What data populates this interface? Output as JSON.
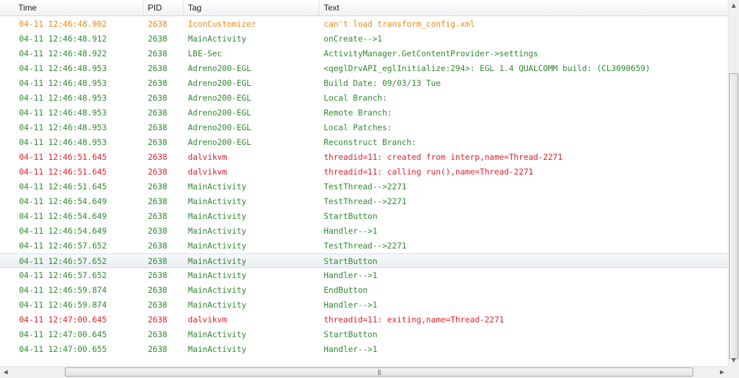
{
  "columns": {
    "time": "Time",
    "pid": "PID",
    "tag": "Tag",
    "text": "Text"
  },
  "colors": {
    "info": "#2f8a2f",
    "warn": "#e8891a",
    "error": "#e0202a"
  },
  "selected_row": 16,
  "rows": [
    {
      "time": "04-11 12:46:48.902",
      "pid": "2638",
      "tag": "IconCustomizer",
      "text": "can't load transform_config.xml",
      "level": "warn"
    },
    {
      "time": "04-11 12:46:48.912",
      "pid": "2638",
      "tag": "MainActivity",
      "text": "onCreate-->1",
      "level": "info"
    },
    {
      "time": "04-11 12:46:48.922",
      "pid": "2638",
      "tag": "LBE-Sec",
      "text": "ActivityManager.GetContentProvider->settings",
      "level": "info"
    },
    {
      "time": "04-11 12:46:48.953",
      "pid": "2638",
      "tag": "Adreno200-EGL",
      "text": "<qeglDrvAPI_eglInitialize:294>: EGL 1.4 QUALCOMM build:  (CL3090659)",
      "level": "info"
    },
    {
      "time": "04-11 12:46:48.953",
      "pid": "2638",
      "tag": "Adreno200-EGL",
      "text": "Build Date: 09/03/13 Tue",
      "level": "info"
    },
    {
      "time": "04-11 12:46:48.953",
      "pid": "2638",
      "tag": "Adreno200-EGL",
      "text": "Local Branch:",
      "level": "info"
    },
    {
      "time": "04-11 12:46:48.953",
      "pid": "2638",
      "tag": "Adreno200-EGL",
      "text": "Remote Branch:",
      "level": "info"
    },
    {
      "time": "04-11 12:46:48.953",
      "pid": "2638",
      "tag": "Adreno200-EGL",
      "text": "Local Patches:",
      "level": "info"
    },
    {
      "time": "04-11 12:46:48.953",
      "pid": "2638",
      "tag": "Adreno200-EGL",
      "text": "Reconstruct Branch:",
      "level": "info"
    },
    {
      "time": "04-11 12:46:51.645",
      "pid": "2638",
      "tag": "dalvikvm",
      "text": "threadid=11: created from interp,name=Thread-2271",
      "level": "error"
    },
    {
      "time": "04-11 12:46:51.645",
      "pid": "2638",
      "tag": "dalvikvm",
      "text": "threadid=11: calling run(),name=Thread-2271",
      "level": "error"
    },
    {
      "time": "04-11 12:46:51.645",
      "pid": "2638",
      "tag": "MainActivity",
      "text": "TestThread-->2271",
      "level": "info"
    },
    {
      "time": "04-11 12:46:54.649",
      "pid": "2638",
      "tag": "MainActivity",
      "text": "TestThread-->2271",
      "level": "info"
    },
    {
      "time": "04-11 12:46:54.649",
      "pid": "2638",
      "tag": "MainActivity",
      "text": "StartButton",
      "level": "info"
    },
    {
      "time": "04-11 12:46:54.649",
      "pid": "2638",
      "tag": "MainActivity",
      "text": "Handler-->1",
      "level": "info"
    },
    {
      "time": "04-11 12:46:57.652",
      "pid": "2638",
      "tag": "MainActivity",
      "text": "TestThread-->2271",
      "level": "info"
    },
    {
      "time": "04-11 12:46:57.652",
      "pid": "2638",
      "tag": "MainActivity",
      "text": "StartButton",
      "level": "info"
    },
    {
      "time": "04-11 12:46:57.652",
      "pid": "2638",
      "tag": "MainActivity",
      "text": "Handler-->1",
      "level": "info"
    },
    {
      "time": "04-11 12:46:59.874",
      "pid": "2638",
      "tag": "MainActivity",
      "text": "EndButton",
      "level": "info"
    },
    {
      "time": "04-11 12:46:59.874",
      "pid": "2638",
      "tag": "MainActivity",
      "text": "Handler-->1",
      "level": "info"
    },
    {
      "time": "04-11 12:47:00.645",
      "pid": "2638",
      "tag": "dalvikvm",
      "text": "threadid=11: exiting,name=Thread-2271",
      "level": "error"
    },
    {
      "time": "04-11 12:47:00.645",
      "pid": "2638",
      "tag": "MainActivity",
      "text": "StartButton",
      "level": "info"
    },
    {
      "time": "04-11 12:47:00.655",
      "pid": "2638",
      "tag": "MainActivity",
      "text": "Handler-->1",
      "level": "info"
    }
  ],
  "scrollbar": {
    "up_icon": "arrow-up-icon",
    "down_icon": "arrow-down-icon",
    "left_icon": "arrow-left-icon",
    "right_icon": "arrow-right-icon"
  }
}
